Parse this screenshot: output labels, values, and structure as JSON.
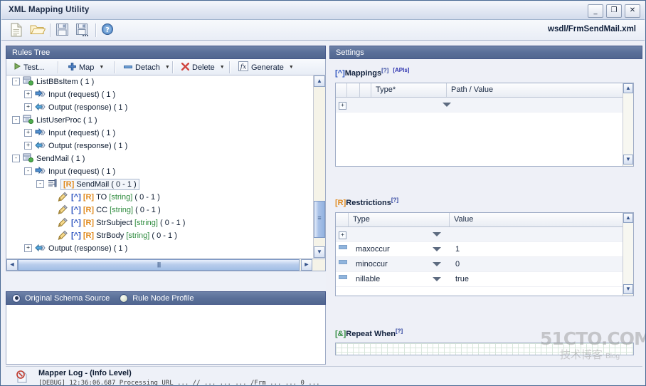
{
  "window": {
    "title": "XML Mapping Utility",
    "buttons": {
      "minimize": "_",
      "maximize": "❐",
      "close": "✕"
    }
  },
  "toolbar": {
    "items": [
      {
        "name": "new-document-icon",
        "label": "New"
      },
      {
        "name": "open-folder-icon",
        "label": "Open"
      },
      {
        "name": "save-icon",
        "label": "Save"
      },
      {
        "name": "save-as-icon",
        "label": "Save As"
      },
      {
        "name": "help-icon",
        "label": "Help"
      }
    ],
    "file_path": "wsdl/FrmSendMail.xml"
  },
  "left": {
    "header": "Rules Tree",
    "actions": [
      {
        "label": "Test...",
        "icon": "play-icon",
        "dropdown": false
      },
      {
        "label": "Map",
        "icon": "plus-icon",
        "dropdown": true
      },
      {
        "label": "Detach",
        "icon": "dash-icon",
        "dropdown": true
      },
      {
        "label": "Delete",
        "icon": "delete-x-icon",
        "dropdown": true
      },
      {
        "label": "Generate",
        "icon": "function-icon",
        "dropdown": true
      }
    ],
    "tree": [
      {
        "indent": 1,
        "expander": "-",
        "icon": "output-icon",
        "label": "Output (response) ( 1 )",
        "partial": true
      },
      {
        "indent": 0,
        "expander": "-",
        "icon": "service-icon",
        "label": "ListBBsItem ( 1 )"
      },
      {
        "indent": 1,
        "expander": "+",
        "icon": "input-icon",
        "label": "Input (request) ( 1 )"
      },
      {
        "indent": 1,
        "expander": "+",
        "icon": "output-icon",
        "label": "Output (response) ( 1 )"
      },
      {
        "indent": 0,
        "expander": "-",
        "icon": "service-icon",
        "label": "ListUserProc ( 1 )"
      },
      {
        "indent": 1,
        "expander": "+",
        "icon": "input-icon",
        "label": "Input (request) ( 1 )"
      },
      {
        "indent": 1,
        "expander": "+",
        "icon": "output-icon",
        "label": "Output (response) ( 1 )"
      },
      {
        "indent": 0,
        "expander": "-",
        "icon": "service-icon",
        "label": "SendMail ( 1 )"
      },
      {
        "indent": 1,
        "expander": "-",
        "icon": "input-icon",
        "label": "Input (request) ( 1 )"
      },
      {
        "indent": 2,
        "expander": "-",
        "icon": "element-icon",
        "selected": true,
        "tagR": "[R]",
        "label": "SendMail ( 0 - 1 )"
      },
      {
        "indent": 3,
        "expander": "",
        "icon": "pencil-icon",
        "tagC": "[^]",
        "tagR": "[R]",
        "label": "TO",
        "type": "[string]",
        "card": "( 0 - 1 )"
      },
      {
        "indent": 3,
        "expander": "",
        "icon": "pencil-icon",
        "tagC": "[^]",
        "tagR": "[R]",
        "label": "CC",
        "type": "[string]",
        "card": "( 0 - 1 )"
      },
      {
        "indent": 3,
        "expander": "",
        "icon": "pencil-icon",
        "tagC": "[^]",
        "tagR": "[R]",
        "label": "StrSubject",
        "type": "[string]",
        "card": "( 0 - 1 )"
      },
      {
        "indent": 3,
        "expander": "",
        "icon": "pencil-icon",
        "tagC": "[^]",
        "tagR": "[R]",
        "label": "StrBody",
        "type": "[string]",
        "card": "( 0 - 1 )"
      },
      {
        "indent": 1,
        "expander": "+",
        "icon": "output-icon",
        "label": "Output (response) ( 1 )"
      }
    ],
    "source_tabs": [
      {
        "label": "Original Schema Source",
        "selected": true
      },
      {
        "label": "Rule Node Profile",
        "selected": false
      }
    ]
  },
  "right": {
    "header": "Settings",
    "mappings": {
      "tag": "[^]",
      "title": "Mappings",
      "help": "[?]",
      "apis": "[APIs]",
      "columns": [
        "",
        "",
        "",
        "Type*",
        "Path / Value"
      ],
      "rows": [
        {
          "expander": "+",
          "type": "",
          "value": "",
          "dropdown": true
        }
      ]
    },
    "restrictions": {
      "tag": "[R]",
      "title": "Restrictions",
      "help": "[?]",
      "columns": [
        "",
        "Type",
        "Value"
      ],
      "rows": [
        {
          "marker": "plus",
          "type": "",
          "value": "",
          "dropdown": true
        },
        {
          "marker": "dash",
          "type": "maxoccur",
          "value": "1",
          "dropdown": true
        },
        {
          "marker": "dash",
          "type": "minoccur",
          "value": "0",
          "dropdown": true
        },
        {
          "marker": "dash",
          "type": "nillable",
          "value": "true",
          "dropdown": true
        }
      ]
    },
    "repeat_when": {
      "tag": "[&]",
      "title": "Repeat When",
      "help": "[?]",
      "value": "",
      "placeholder": ""
    }
  },
  "log": {
    "icon": "log-error-icon",
    "title": "Mapper Log - (Info Level)",
    "line": "[DEBUG]   12:36:06.687   Processing URL ... // ... ... ... /Frm ... ... 0  ..."
  },
  "watermark": {
    "line1": "51CTO.COM",
    "line2": "技术博客",
    "line3": "Blog"
  },
  "colors": {
    "title_text": "#1b2a45",
    "panel_header": "#5a6f99",
    "accent_orange": "#e08a1e",
    "accent_blue": "#2a52be",
    "type_green": "#2e8b3d"
  }
}
